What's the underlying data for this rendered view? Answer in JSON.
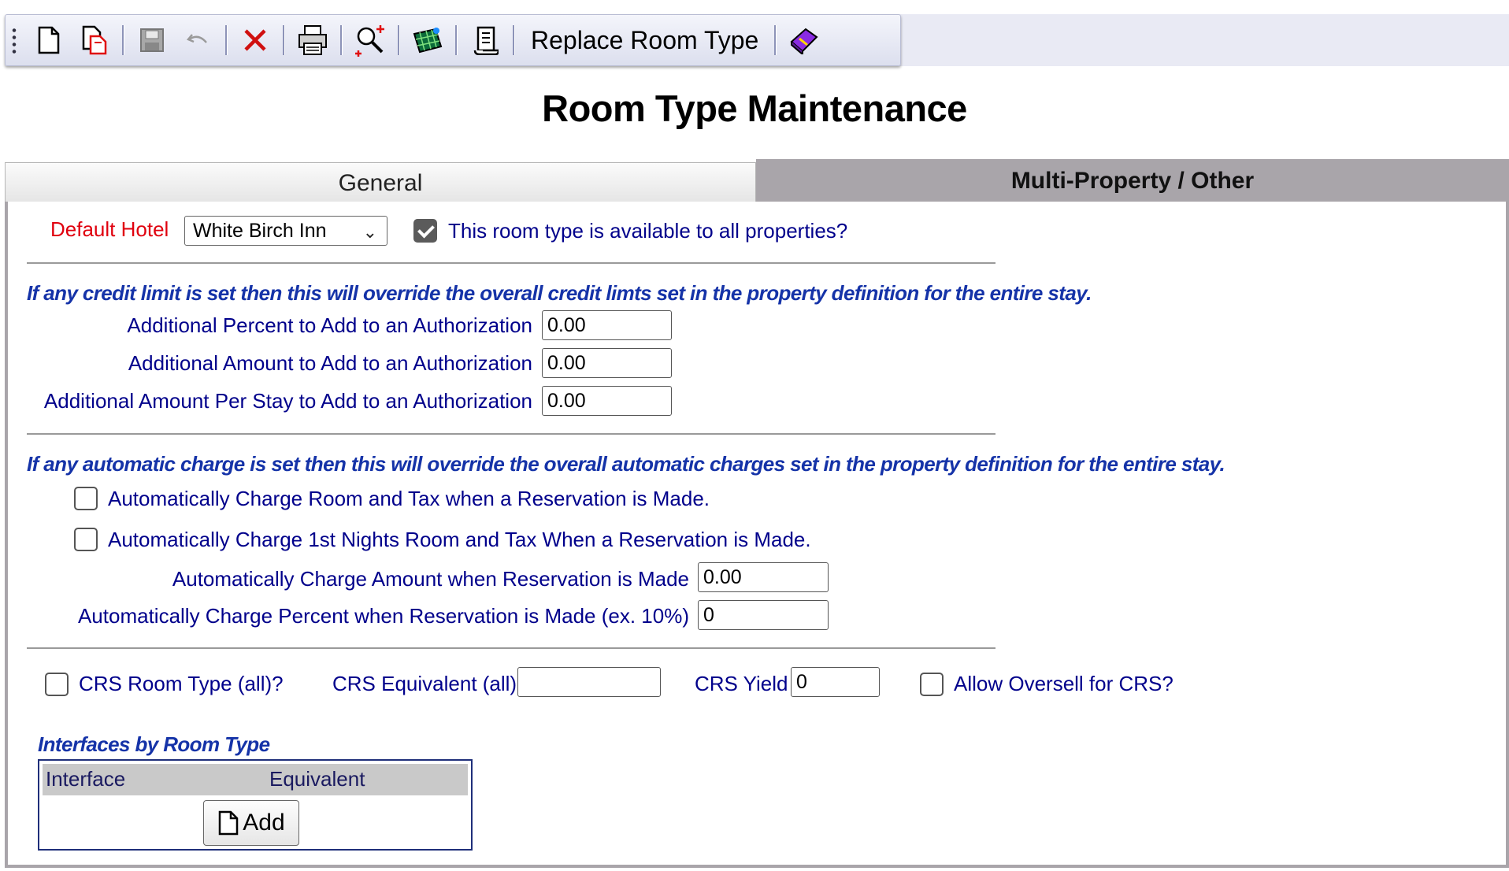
{
  "toolbar": {
    "buttons": [
      {
        "icon": "new-document-icon"
      },
      {
        "icon": "copy-document-icon"
      },
      {
        "icon": "save-icon"
      },
      {
        "icon": "undo-icon"
      },
      {
        "icon": "delete-icon"
      },
      {
        "icon": "print-icon"
      },
      {
        "icon": "search-add-icon"
      },
      {
        "icon": "grid-icon"
      },
      {
        "icon": "scroll-icon"
      },
      {
        "icon": "book-icon"
      }
    ],
    "replace_label": "Replace Room Type"
  },
  "page": {
    "title": "Room Type Maintenance"
  },
  "tabs": {
    "general": "General",
    "multi": "Multi-Property / Other",
    "active": "multi"
  },
  "form": {
    "default_hotel_label": "Default Hotel",
    "default_hotel_value": "White Birch Inn",
    "all_properties_label": "This room type is available to all properties?",
    "all_properties_checked": true,
    "credit_note": "If any credit limit is set then this will override the overall credit limts set in the property definition for the entire stay.",
    "add_percent_label": "Additional Percent to Add to an Authorization",
    "add_percent_value": "0.00",
    "add_amount_label": "Additional Amount to Add to an Authorization",
    "add_amount_value": "0.00",
    "add_per_stay_label": "Additional Amount Per Stay to Add to an Authorization",
    "add_per_stay_value": "0.00",
    "charge_note": "If any automatic charge is set then this will override the overall automatic charges set in the property definition for the entire stay.",
    "auto_charge_room_tax_label": "Automatically Charge Room and Tax when a Reservation is Made.",
    "auto_charge_first_night_label": "Automatically Charge 1st Nights Room and Tax When a Reservation is Made.",
    "auto_charge_amount_label": "Automatically Charge Amount when Reservation is Made",
    "auto_charge_amount_value": "0.00",
    "auto_charge_percent_label": "Automatically Charge Percent when Reservation is Made (ex. 10%)",
    "auto_charge_percent_value": "0",
    "crs_room_type_label": "CRS Room Type (all)?",
    "crs_equivalent_label": "CRS Equivalent (all)",
    "crs_equivalent_value": "",
    "crs_yield_label": "CRS Yield",
    "crs_yield_value": "0",
    "allow_oversell_label": "Allow Oversell for CRS?"
  },
  "interfaces": {
    "title": "Interfaces by Room Type",
    "col_interface": "Interface",
    "col_equivalent": "Equivalent",
    "add_label": "Add"
  },
  "colors": {
    "label": "#00008b",
    "required": "#e0000e",
    "note": "#1533a8",
    "tab_active": "#a9a5aa"
  }
}
